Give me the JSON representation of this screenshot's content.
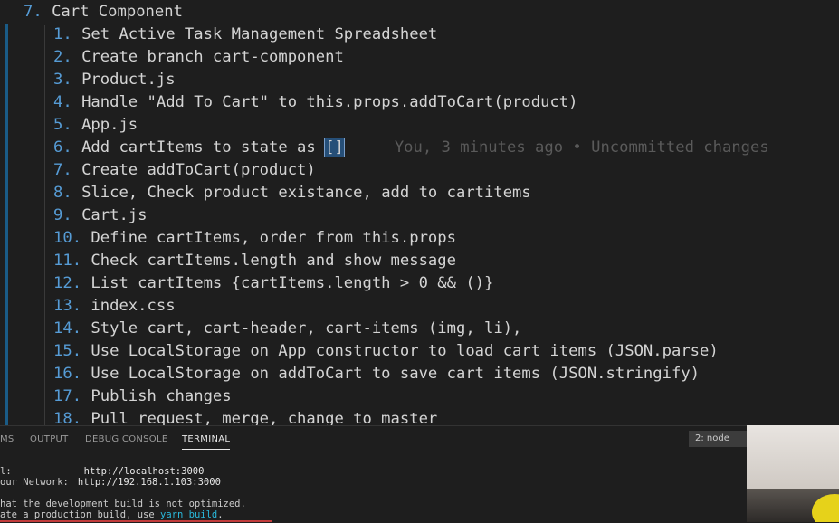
{
  "editor": {
    "heading_num": "7.",
    "heading_text": "Cart Component",
    "items": [
      {
        "num": "1.",
        "text": "Set Active Task Management Spreadsheet"
      },
      {
        "num": "2.",
        "text": "Create branch cart-component"
      },
      {
        "num": "3.",
        "text": "Product.js"
      },
      {
        "num": "4.",
        "text": "Handle \"Add To Cart\" to this.props.addToCart(product)"
      },
      {
        "num": "5.",
        "text": "App.js"
      },
      {
        "num": "6.",
        "text_before": "Add cartItems to state as ",
        "selected": "[]",
        "blame": "You, 3 minutes ago • Uncommitted changes"
      },
      {
        "num": "7.",
        "text": "Create addToCart(product)"
      },
      {
        "num": "8.",
        "text": "Slice, Check product existance, add to cartitems"
      },
      {
        "num": "9.",
        "text": "Cart.js"
      },
      {
        "num": "10.",
        "text": "Define cartItems, order from this.props"
      },
      {
        "num": "11.",
        "text": "Check cartItems.length and show message"
      },
      {
        "num": "12.",
        "text": "List cartItems {cartItems.length > 0 && ()}"
      },
      {
        "num": "13.",
        "text": "index.css"
      },
      {
        "num": "14.",
        "text": "Style cart, cart-header, cart-items (img, li),"
      },
      {
        "num": "15.",
        "text": "Use LocalStorage on App constructor to load cart items (JSON.parse)"
      },
      {
        "num": "16.",
        "text": "Use LocalStorage on addToCart to save cart items (JSON.stringify)"
      },
      {
        "num": "17.",
        "text": "Publish changes"
      },
      {
        "num": "18.",
        "text": "Pull request, merge, change to master"
      }
    ]
  },
  "panel": {
    "tabs": [
      "MS",
      "OUTPUT",
      "DEBUG CONSOLE",
      "TERMINAL"
    ],
    "active_tab": "TERMINAL",
    "terminal_select": "2: node",
    "terminal_lines": {
      "local_label": "l:",
      "local_url": "http://localhost:3000",
      "network_label": "our Network:",
      "network_url": "http://192.168.1.103:3000",
      "note1": "hat the development build is not optimized.",
      "note2_before": "ate a production build, use ",
      "note2_cmd": "yarn build",
      "note2_after": "."
    }
  }
}
